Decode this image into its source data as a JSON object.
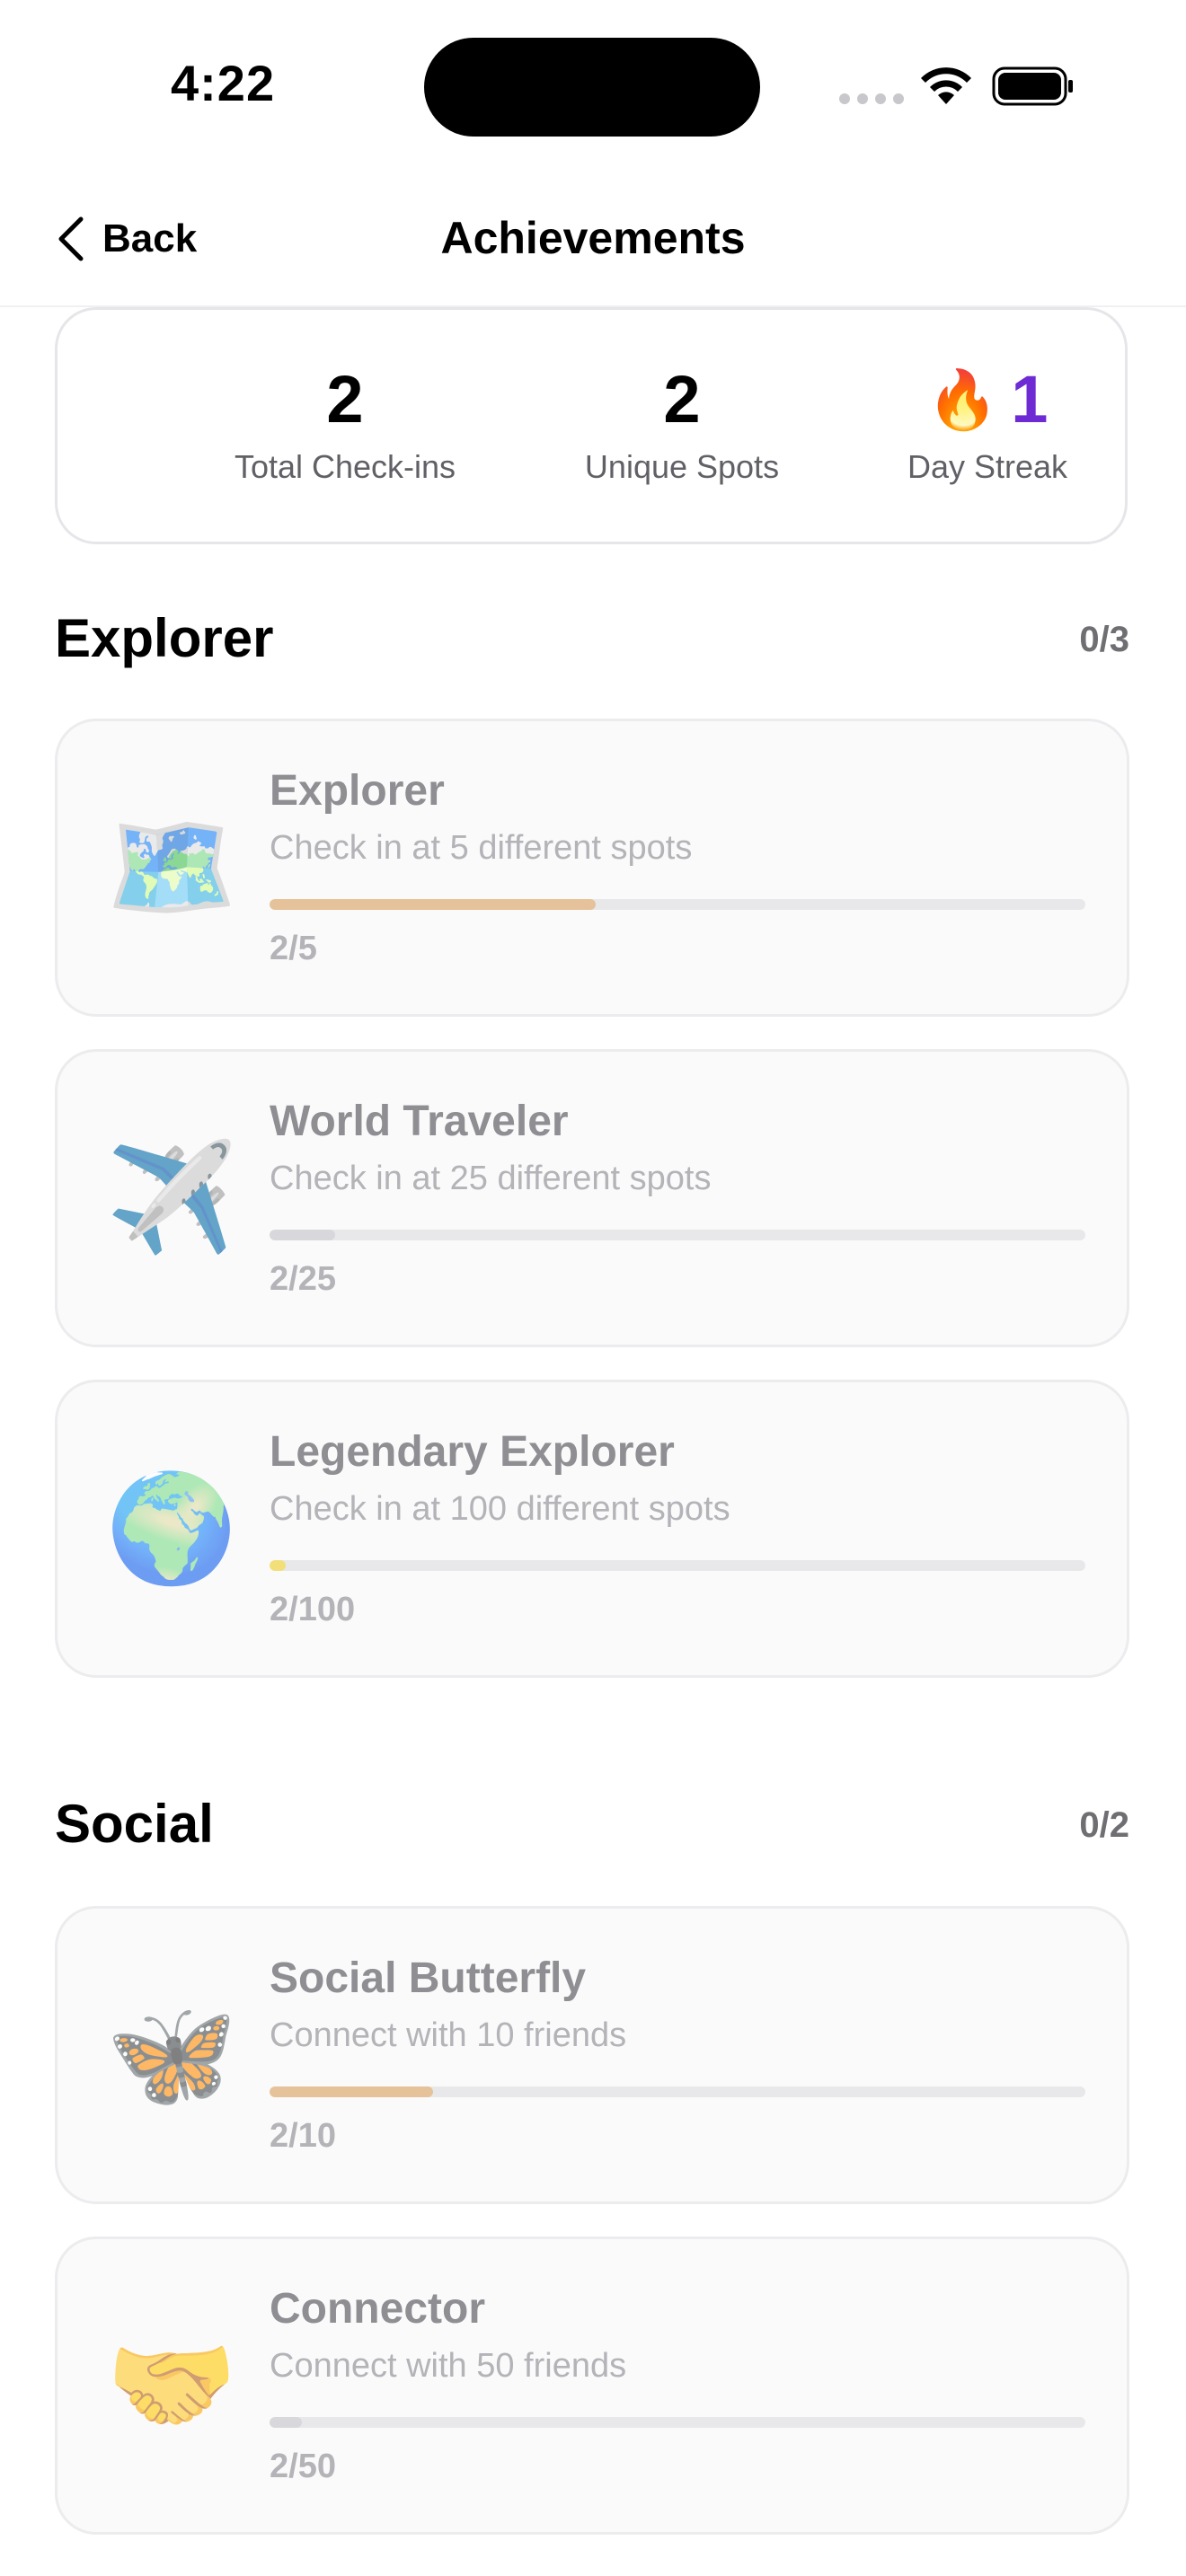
{
  "status_bar": {
    "time": "4:22"
  },
  "nav": {
    "back_label": "Back",
    "title": "Achievements"
  },
  "stats": {
    "total_checkins": {
      "value": "2",
      "label": "Total Check-ins"
    },
    "unique_spots": {
      "value": "2",
      "label": "Unique Spots"
    },
    "day_streak": {
      "icon": "fire-icon",
      "glyph": "🔥",
      "value": "1",
      "label": "Day Streak"
    }
  },
  "colors": {
    "streak_accent": "#6e2bd3",
    "progress_explorer": "#e5c29a",
    "progress_traveler": "#d8d8dc",
    "progress_legendary": "#f2df7a",
    "progress_social": "#e5c29a",
    "progress_connector": "#d8d8dc"
  },
  "sections": [
    {
      "title": "Explorer",
      "count": "0/3",
      "items": [
        {
          "icon": "map-icon",
          "glyph": "🗺️",
          "title": "Explorer",
          "description": "Check in at 5 different spots",
          "progress_text": "2/5",
          "progress": 0.4,
          "color_key": "progress_explorer"
        },
        {
          "icon": "airplane-icon",
          "glyph": "✈️",
          "title": "World Traveler",
          "description": "Check in at 25 different spots",
          "progress_text": "2/25",
          "progress": 0.08,
          "color_key": "progress_traveler"
        },
        {
          "icon": "globe-icon",
          "glyph": "🌍",
          "title": "Legendary Explorer",
          "description": "Check in at 100 different spots",
          "progress_text": "2/100",
          "progress": 0.02,
          "color_key": "progress_legendary"
        }
      ]
    },
    {
      "title": "Social",
      "count": "0/2",
      "items": [
        {
          "icon": "butterfly-icon",
          "glyph": "🦋",
          "title": "Social Butterfly",
          "description": "Connect with 10 friends",
          "progress_text": "2/10",
          "progress": 0.2,
          "color_key": "progress_social"
        },
        {
          "icon": "handshake-icon",
          "glyph": "🤝",
          "title": "Connector",
          "description": "Connect with 50 friends",
          "progress_text": "2/50",
          "progress": 0.04,
          "color_key": "progress_connector"
        }
      ]
    }
  ]
}
